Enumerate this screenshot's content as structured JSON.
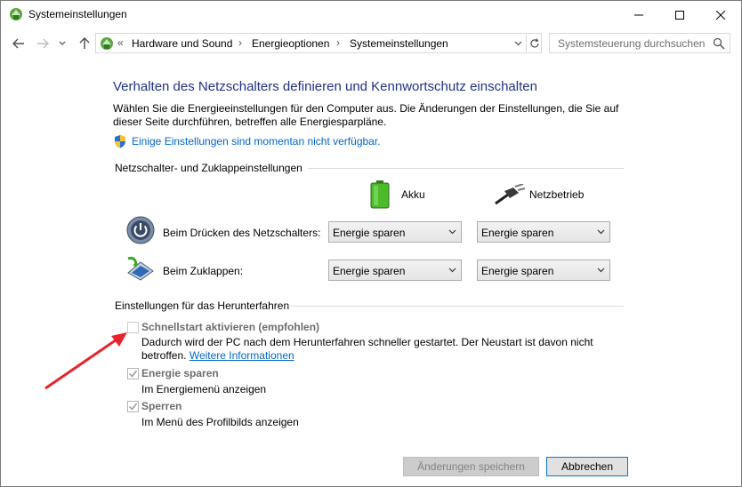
{
  "window": {
    "title": "Systemeinstellungen",
    "accent": "#1e3287",
    "link_color": "#0066cc"
  },
  "navigation": {
    "breadcrumbs": [
      "Hardware und Sound",
      "Energieoptionen",
      "Systemeinstellungen"
    ],
    "overflow": "«",
    "separator": "›",
    "search_placeholder": "Systemsteuerung durchsuchen"
  },
  "main": {
    "heading": "Verhalten des Netzschalters definieren und Kennwortschutz einschalten",
    "description": "Wählen Sie die Energieeinstellungen für den Computer aus. Die Änderungen der Einstellungen, die Sie auf dieser Seite durchführen, betreffen alle Energiesparpläne.",
    "admin_link": "Einige Einstellungen sind momentan nicht verfügbar."
  },
  "power_section": {
    "title": "Netzschalter- und Zuklappeinstellungen",
    "columns": {
      "battery": "Akku",
      "plugged_in": "Netzbetrieb"
    },
    "rows": [
      {
        "label": "Beim Drücken des Netzschalters:",
        "battery_value": "Energie sparen",
        "plugged_value": "Energie sparen",
        "icon": "power-button-icon"
      },
      {
        "label": "Beim Zuklappen:",
        "battery_value": "Energie sparen",
        "plugged_value": "Energie sparen",
        "icon": "laptop-lid-icon"
      }
    ]
  },
  "shutdown_section": {
    "title": "Einstellungen für das Herunterfahren",
    "options": [
      {
        "label": "Schnellstart aktivieren (empfohlen)",
        "checked": false,
        "desc": "Dadurch wird der PC nach dem Herunterfahren schneller gestartet. Der Neustart ist davon nicht betroffen.",
        "link": "Weitere Informationen"
      },
      {
        "label": "Energie sparen",
        "checked": true,
        "desc": "Im Energiemenü anzeigen"
      },
      {
        "label": "Sperren",
        "checked": true,
        "desc": "Im Menü des Profilbilds anzeigen"
      }
    ]
  },
  "footer": {
    "save_label": "Änderungen speichern",
    "cancel_label": "Abbrechen"
  },
  "annotation_color": "#e8232a"
}
